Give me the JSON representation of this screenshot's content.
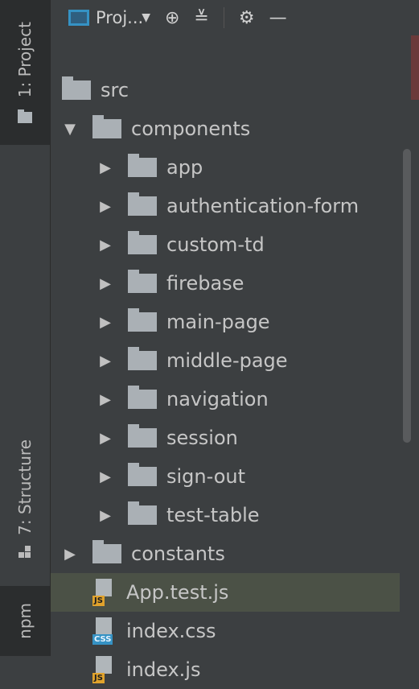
{
  "sidebar": {
    "project_tab": "1: Project",
    "structure_tab": "7: Structure",
    "npm_tab": "npm"
  },
  "toolbar": {
    "title": "Proj...",
    "icons": [
      "dropdown-caret",
      "locate-icon",
      "collapse-icon",
      "gear-icon",
      "minimize-icon"
    ]
  },
  "tree": {
    "items": [
      {
        "label": "src",
        "kind": "folder",
        "level": 0,
        "expanded": null
      },
      {
        "label": "components",
        "kind": "folder",
        "level": 1,
        "expanded": true
      },
      {
        "label": "app",
        "kind": "folder",
        "level": 2,
        "expanded": false
      },
      {
        "label": "authentication-form",
        "kind": "folder",
        "level": 2,
        "expanded": false
      },
      {
        "label": "custom-td",
        "kind": "folder",
        "level": 2,
        "expanded": false
      },
      {
        "label": "firebase",
        "kind": "folder",
        "level": 2,
        "expanded": false
      },
      {
        "label": "main-page",
        "kind": "folder",
        "level": 2,
        "expanded": false
      },
      {
        "label": "middle-page",
        "kind": "folder",
        "level": 2,
        "expanded": false
      },
      {
        "label": "navigation",
        "kind": "folder",
        "level": 2,
        "expanded": false
      },
      {
        "label": "session",
        "kind": "folder",
        "level": 2,
        "expanded": false
      },
      {
        "label": "sign-out",
        "kind": "folder",
        "level": 2,
        "expanded": false
      },
      {
        "label": "test-table",
        "kind": "folder",
        "level": 2,
        "expanded": false
      },
      {
        "label": "constants",
        "kind": "folder",
        "level": 1,
        "expanded": false
      },
      {
        "label": "App.test.js",
        "kind": "file",
        "level": 1,
        "filetype": "JS",
        "selected": true
      },
      {
        "label": "index.css",
        "kind": "file",
        "level": 1,
        "filetype": "CSS"
      },
      {
        "label": "index.js",
        "kind": "file",
        "level": 1,
        "filetype": "JS"
      }
    ]
  },
  "colors": {
    "background": "#3c3f41",
    "selection": "#4b5146",
    "accent": "#3592c4",
    "js_badge": "#e0a22c"
  }
}
